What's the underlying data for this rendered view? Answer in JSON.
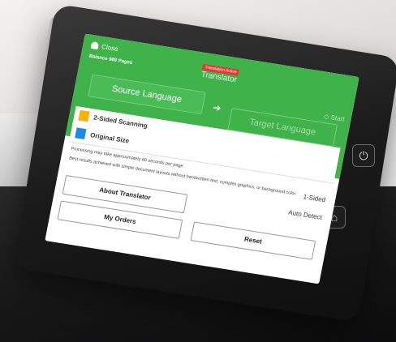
{
  "header": {
    "close_label": "Close",
    "balance_label": "Balance 989 Pages",
    "badge": "Translation Active",
    "title": "Translator",
    "source_language": "Source Language",
    "target_language": "Target Language",
    "start_label": "Start"
  },
  "settings": [
    {
      "label": "2-Sided Scanning",
      "value": "1-Sided"
    },
    {
      "label": "Original Size",
      "value": "Auto Detect"
    }
  ],
  "notes": {
    "processing": "Processing may take approximately 60 seconds per page.",
    "best_results": "Best results achieved with simple document layouts without handwritten text, complex graphics, or background color."
  },
  "buttons": {
    "about": "About Translator",
    "my_orders": "My Orders",
    "reset": "Reset"
  },
  "colors": {
    "header_green": "#3fb24a",
    "badge_red": "#e53935"
  },
  "icons": {
    "power": "power-icon",
    "home": "home-icon",
    "close": "user-icon"
  }
}
